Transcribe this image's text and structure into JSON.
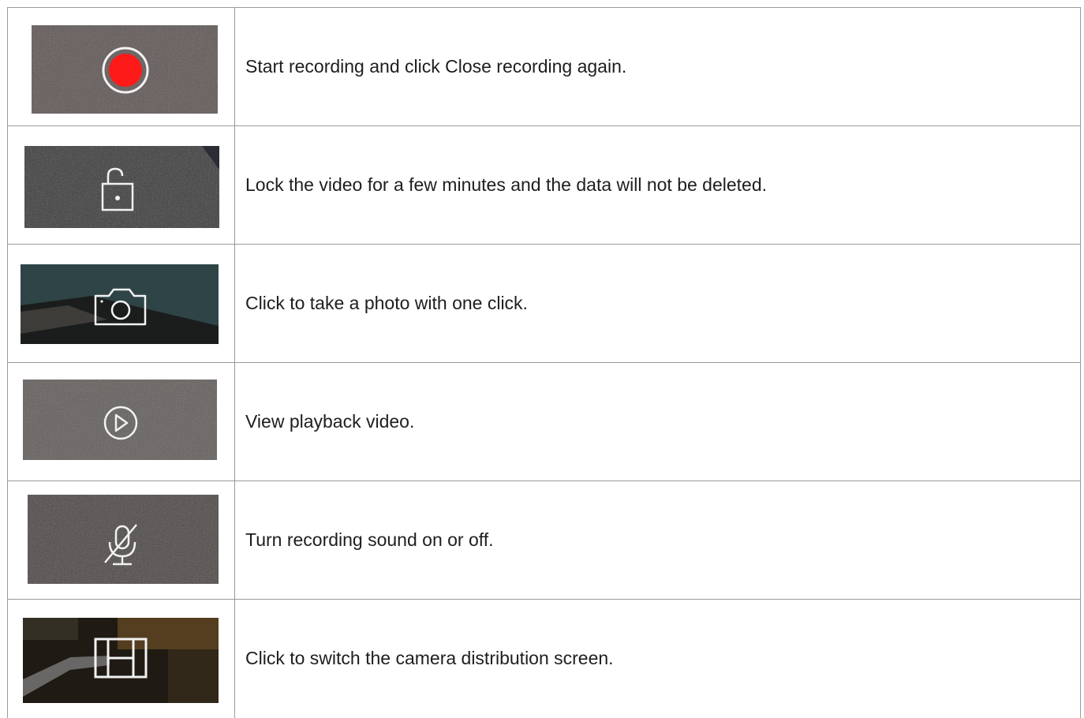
{
  "rows": [
    {
      "icon": "record-icon",
      "text": "Start recording and click Close recording again."
    },
    {
      "icon": "unlock-icon",
      "text": "Lock the video for a few minutes and the data will not be deleted."
    },
    {
      "icon": "camera-icon",
      "text": "Click to take a photo with one click."
    },
    {
      "icon": "play-icon",
      "text": "View playback video."
    },
    {
      "icon": "mic-off-icon",
      "text": "Turn recording sound on or off."
    },
    {
      "icon": "layout-icon",
      "text": "Click to switch the camera distribution screen."
    }
  ],
  "colors": {
    "record_red": "#ff1a1a",
    "icon_stroke": "#f2f2f2",
    "border": "#9a9a9a",
    "text": "#1e1e1e"
  }
}
